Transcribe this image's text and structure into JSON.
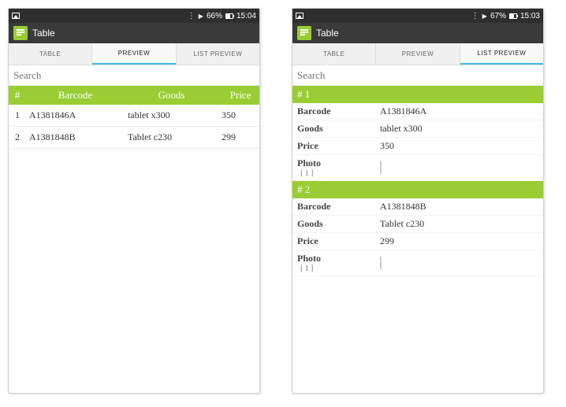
{
  "common": {
    "app_title": "Table",
    "tab_table": "TABLE",
    "tab_preview": "PREVIEW",
    "tab_list_preview": "LIST PREVIEW",
    "search_placeholder": "Search"
  },
  "phone_left": {
    "status_time": "15:04",
    "status_battery": "66%",
    "active_tab": "PREVIEW",
    "columns": {
      "idx": "#",
      "barcode": "Barcode",
      "goods": "Goods",
      "price": "Price"
    },
    "rows": [
      {
        "idx": "1",
        "barcode": "A1381846A",
        "goods": "tablet x300",
        "price": "350"
      },
      {
        "idx": "2",
        "barcode": "A1381848B",
        "goods": "Tablet c230",
        "price": "299"
      }
    ]
  },
  "phone_right": {
    "status_time": "15:03",
    "status_battery": "67%",
    "active_tab": "LIST PREVIEW",
    "records": [
      {
        "head": "# 1",
        "barcode_label": "Barcode",
        "barcode": "A1381846A",
        "goods_label": "Goods",
        "goods": "tablet x300",
        "price_label": "Price",
        "price": "350",
        "photo_label": "Photo",
        "photo_count": "[ 1 ]"
      },
      {
        "head": "# 2",
        "barcode_label": "Barcode",
        "barcode": "A1381848B",
        "goods_label": "Goods",
        "goods": "Tablet c230",
        "price_label": "Price",
        "price": "299",
        "photo_label": "Photo",
        "photo_count": "[ 1 ]"
      }
    ]
  }
}
